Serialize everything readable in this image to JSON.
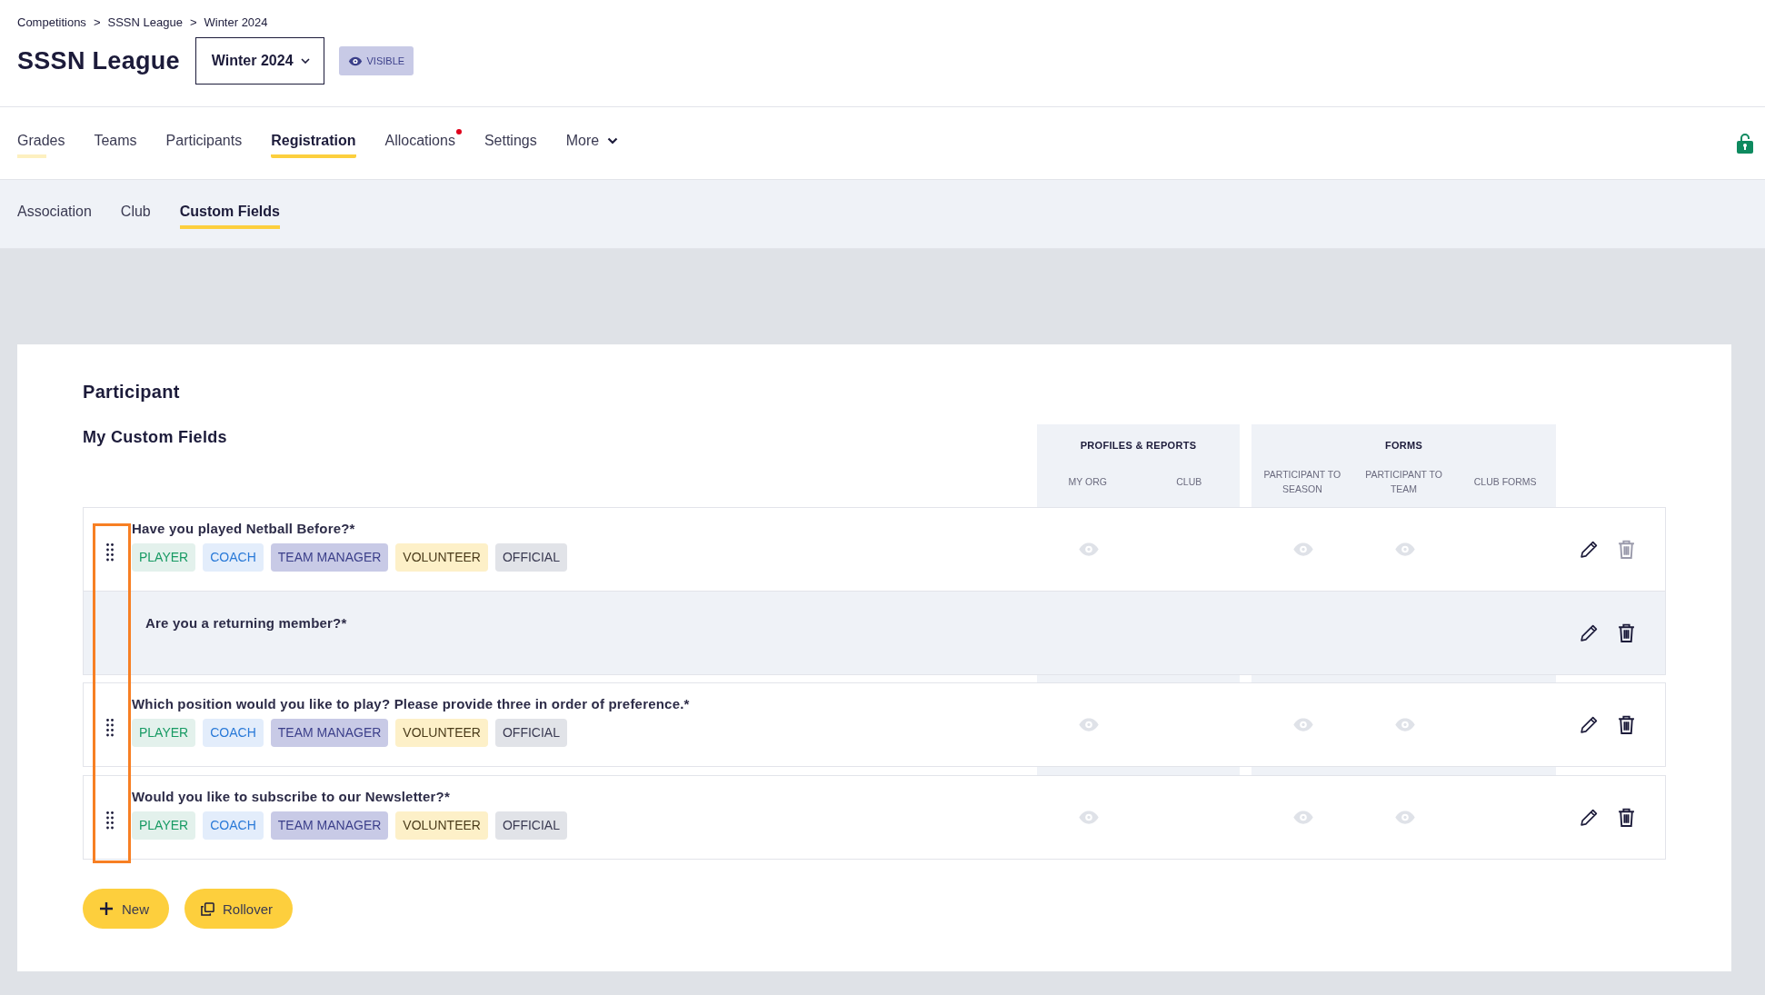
{
  "breadcrumb": [
    "Competitions",
    "SSSN League",
    "Winter 2024"
  ],
  "breadcrumb_separator": ">",
  "title": "SSSN League",
  "season_dropdown": {
    "value": "Winter 2024"
  },
  "visibility_badge": {
    "label": "VISIBLE"
  },
  "tabs": [
    {
      "label": "Grades",
      "selected": false,
      "hovered": true,
      "notification": false
    },
    {
      "label": "Teams",
      "selected": false,
      "hovered": false,
      "notification": false
    },
    {
      "label": "Participants",
      "selected": false,
      "hovered": false,
      "notification": false
    },
    {
      "label": "Registration",
      "selected": true,
      "hovered": false,
      "notification": false
    },
    {
      "label": "Allocations",
      "selected": false,
      "hovered": false,
      "notification": true
    },
    {
      "label": "Settings",
      "selected": false,
      "hovered": false,
      "notification": false
    },
    {
      "label": "More",
      "selected": false,
      "hovered": false,
      "notification": false,
      "kind": "menu"
    }
  ],
  "lock": {
    "locked": false
  },
  "subtabs": [
    {
      "label": "Association",
      "selected": false
    },
    {
      "label": "Club",
      "selected": false
    },
    {
      "label": "Custom Fields",
      "selected": true
    }
  ],
  "section_title": "Participant",
  "table": {
    "title": "My Custom Fields",
    "groups": [
      {
        "label": "PROFILES & REPORTS",
        "columns": [
          "MY ORG",
          "CLUB"
        ]
      },
      {
        "label": "FORMS",
        "columns": [
          "PARTICIPANT TO SEASON",
          "PARTICIPANT TO TEAM",
          "CLUB FORMS"
        ]
      }
    ],
    "rows": [
      {
        "question": "Have you played Netball Before?*",
        "highlighted": false,
        "delete_disabled": true,
        "visible": [
          true,
          false,
          true,
          true,
          false
        ],
        "tags": [
          {
            "label": "PLAYER",
            "kind": "player"
          },
          {
            "label": "COACH",
            "kind": "coach"
          },
          {
            "label": "TEAM MANAGER",
            "kind": "team_manager"
          },
          {
            "label": "VOLUNTEER",
            "kind": "volunteer"
          },
          {
            "label": "OFFICIAL",
            "kind": "official"
          }
        ]
      },
      {
        "question": "Are you a returning member?*",
        "highlighted": true,
        "delete_disabled": false,
        "visible": [
          false,
          false,
          false,
          false,
          false
        ],
        "tags": []
      },
      {
        "question": "Which position would you like to play? Please provide three in order of preference.*",
        "highlighted": false,
        "delete_disabled": false,
        "visible": [
          true,
          false,
          true,
          true,
          false
        ],
        "tags": [
          {
            "label": "PLAYER",
            "kind": "player"
          },
          {
            "label": "COACH",
            "kind": "coach"
          },
          {
            "label": "TEAM MANAGER",
            "kind": "team_manager"
          },
          {
            "label": "VOLUNTEER",
            "kind": "volunteer"
          },
          {
            "label": "OFFICIAL",
            "kind": "official"
          }
        ]
      },
      {
        "question": "Would you like to subscribe to our Newsletter?*",
        "highlighted": false,
        "delete_disabled": false,
        "visible": [
          true,
          false,
          true,
          true,
          false
        ],
        "tags": [
          {
            "label": "PLAYER",
            "kind": "player"
          },
          {
            "label": "COACH",
            "kind": "coach"
          },
          {
            "label": "TEAM MANAGER",
            "kind": "team_manager"
          },
          {
            "label": "VOLUNTEER",
            "kind": "volunteer"
          },
          {
            "label": "OFFICIAL",
            "kind": "official"
          }
        ]
      }
    ],
    "highlight_frame": true
  },
  "buttons": [
    {
      "label": "New",
      "kind": "new"
    },
    {
      "label": "Rollover",
      "kind": "rollover"
    }
  ]
}
